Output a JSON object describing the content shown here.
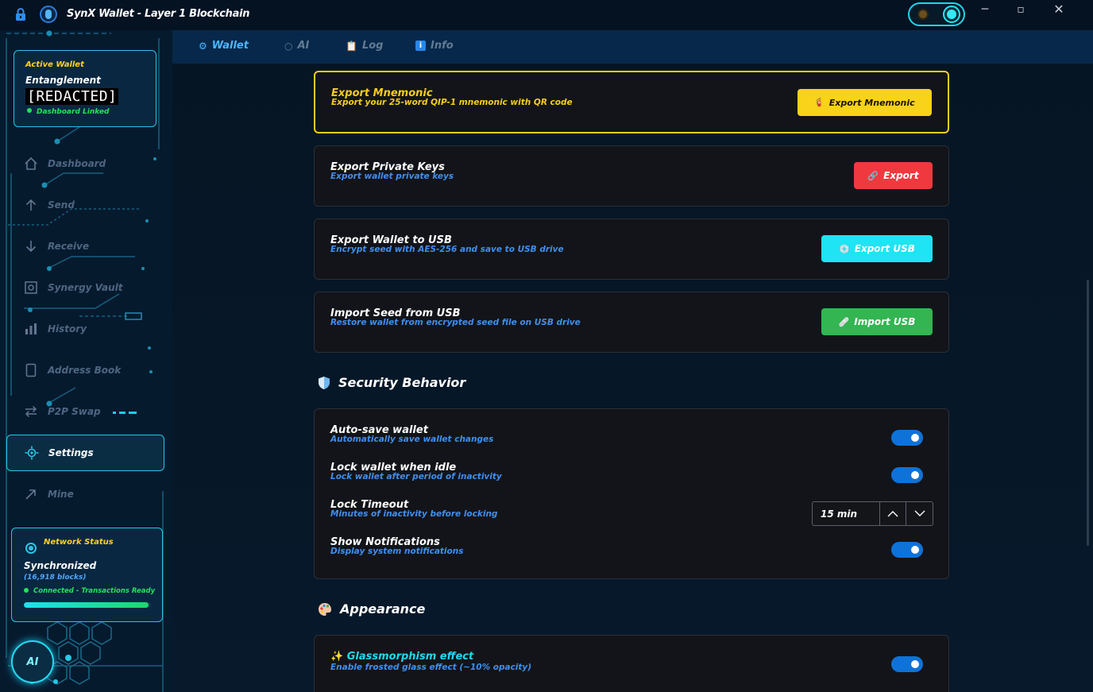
{
  "window": {
    "title": "SynX Wallet - Layer 1 Blockchain",
    "controls": [
      "─",
      "▫",
      "✕"
    ]
  },
  "sidebar": {
    "active_wallet": {
      "label": "Active Wallet",
      "name": "Entanglement",
      "address": "[REDACTED]",
      "status": "Dashboard Linked"
    },
    "items": [
      {
        "label": "Dashboard",
        "icon": "home-icon"
      },
      {
        "label": "Send",
        "icon": "arrow-up-icon"
      },
      {
        "label": "Receive",
        "icon": "arrow-down-icon"
      },
      {
        "label": "Synergy Vault",
        "icon": "vault-icon"
      },
      {
        "label": "History",
        "icon": "bar-chart-icon"
      },
      {
        "label": "Address Book",
        "icon": "book-icon"
      },
      {
        "label": "P2P Swap",
        "icon": "swap-icon"
      },
      {
        "label": "Settings",
        "icon": "settings-icon",
        "active": true
      },
      {
        "label": "Mine",
        "icon": "trend-icon"
      }
    ],
    "network": {
      "label": "Network Status",
      "state": "Synchronized",
      "blocks": "(16,918 blocks)",
      "connection": "Connected - Transactions Ready",
      "progress": 0.98
    },
    "ai_label": "AI"
  },
  "tabs": [
    {
      "label": "Wallet",
      "icon": "gear-icon",
      "active": true
    },
    {
      "label": "AI",
      "icon": "circle-icon"
    },
    {
      "label": "Log",
      "icon": "clipboard-icon"
    },
    {
      "label": "Info",
      "icon": "info-icon"
    }
  ],
  "backup": [
    {
      "title": "Export Mnemonic",
      "subtitle": "Export your 25-word QIP-1 mnemonic with QR code",
      "button": "Export Mnemonic",
      "button_icon": "🧯",
      "color": "#f9d21a",
      "text_color": "#1a1400"
    },
    {
      "title": "Export Private Keys",
      "subtitle": "Export wallet private keys",
      "button": "Export",
      "button_icon": "🔗",
      "color": "#f0393f",
      "text_color": "#ffffff"
    },
    {
      "title": "Export Wallet to USB",
      "subtitle": "Encrypt seed with AES-256 and save to USB drive",
      "button": "Export USB",
      "button_icon": "💿",
      "color": "#1ee4f3",
      "text_color": "#ffffff"
    },
    {
      "title": "Import Seed from USB",
      "subtitle": "Restore wallet from encrypted seed file on USB drive",
      "button": "Import USB",
      "button_icon": "🩹",
      "color": "#33b552",
      "text_color": "#ffffff"
    }
  ],
  "security": {
    "heading": "Security Behavior",
    "rows": [
      {
        "title": "Auto-save wallet",
        "subtitle": "Automatically save wallet changes",
        "enabled": true
      },
      {
        "title": "Lock wallet when idle",
        "subtitle": "Lock wallet after period of inactivity",
        "enabled": true
      },
      {
        "title": "Lock Timeout",
        "subtitle": "Minutes of inactivity before locking",
        "value": "15 min"
      },
      {
        "title": "Show Notifications",
        "subtitle": "Display system notifications",
        "enabled": true
      }
    ]
  },
  "appearance": {
    "heading": "Appearance",
    "rows": [
      {
        "title": "Glassmorphism effect",
        "subtitle": "Enable frosted glass effect (~10% opacity)",
        "enabled": true,
        "icon": "✨"
      }
    ]
  },
  "colors": {
    "accent_cyan": "#27c6e6",
    "accent_blue": "#4fb6ff",
    "highlight_yellow": "#f6cd1c",
    "toggle_blue": "#0f72d8"
  }
}
